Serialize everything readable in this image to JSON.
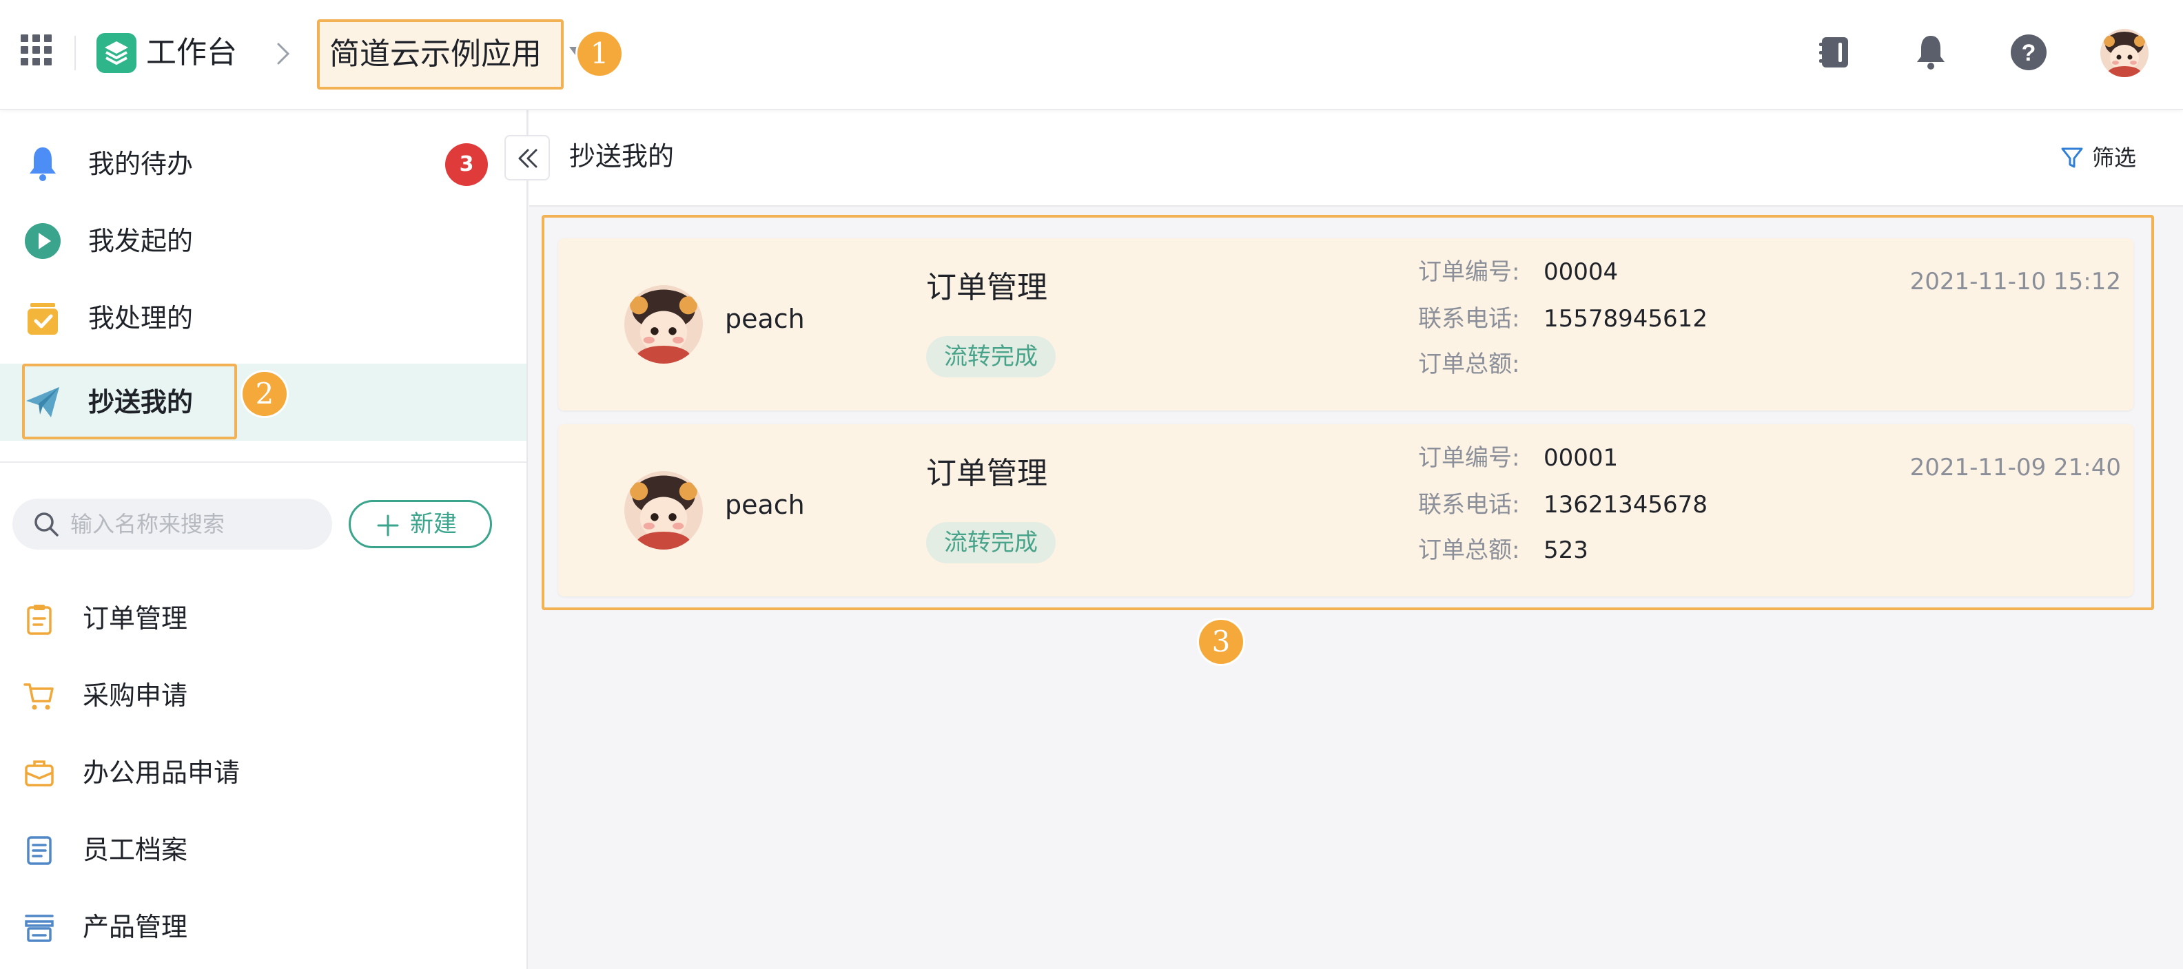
{
  "header": {
    "workbench_label": "工作台",
    "app_name": "简道云示例应用"
  },
  "annotations": {
    "mark1": "1",
    "mark2": "2",
    "mark3": "3"
  },
  "sidebar": {
    "nav": [
      {
        "label": "我的待办",
        "icon": "bell-icon",
        "badge": "3"
      },
      {
        "label": "我发起的",
        "icon": "play-circle-icon"
      },
      {
        "label": "我处理的",
        "icon": "inbox-check-icon"
      },
      {
        "label": "抄送我的",
        "icon": "paper-plane-icon",
        "active": true
      }
    ],
    "search_placeholder": "输入名称来搜索",
    "new_button_label": "新建",
    "forms": [
      {
        "label": "订单管理",
        "icon": "clipboard-icon"
      },
      {
        "label": "采购申请",
        "icon": "cart-icon"
      },
      {
        "label": "办公用品申请",
        "icon": "briefcase-icon"
      },
      {
        "label": "员工档案",
        "icon": "document-icon"
      },
      {
        "label": "产品管理",
        "icon": "store-icon"
      }
    ]
  },
  "main": {
    "title": "抄送我的",
    "filter_label": "筛选",
    "cards": [
      {
        "user": "peach",
        "title": "订单管理",
        "status": "流转完成",
        "fields": [
          {
            "label": "订单编号:",
            "value": "00004"
          },
          {
            "label": "联系电话:",
            "value": "15578945612"
          },
          {
            "label": "订单总额:",
            "value": ""
          }
        ],
        "time": "2021-11-10 15:12"
      },
      {
        "user": "peach",
        "title": "订单管理",
        "status": "流转完成",
        "fields": [
          {
            "label": "订单编号:",
            "value": "00001"
          },
          {
            "label": "联系电话:",
            "value": "13621345678"
          },
          {
            "label": "订单总额:",
            "value": "523"
          }
        ],
        "time": "2021-11-09 21:40"
      }
    ]
  },
  "colors": {
    "accent": "#3aa58c",
    "highlight": "#f2b152",
    "badge": "#e03b3b",
    "card_bg": "#fdf3e4"
  }
}
